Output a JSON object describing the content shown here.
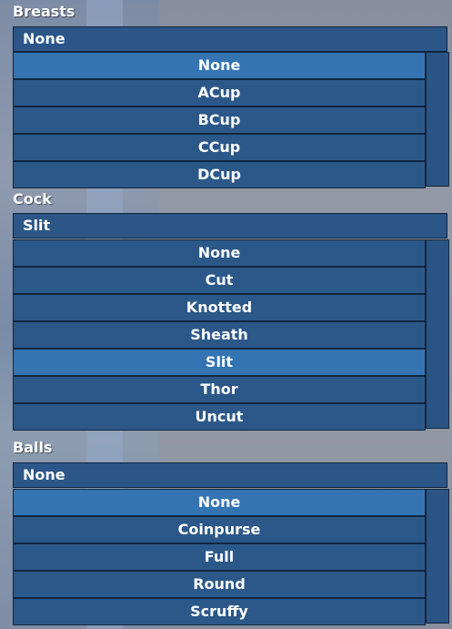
{
  "sections": [
    {
      "title": "Breasts",
      "selected": "None",
      "options": [
        "None",
        "ACup",
        "BCup",
        "CCup",
        "DCup"
      ],
      "highlighted_index": 0
    },
    {
      "title": "Cock",
      "selected": "Slit",
      "options": [
        "None",
        "Cut",
        "Knotted",
        "Sheath",
        "Slit",
        "Thor",
        "Uncut"
      ],
      "highlighted_index": 4
    },
    {
      "title": "Balls",
      "selected": "None",
      "options": [
        "None",
        "Coinpurse",
        "Full",
        "Round",
        "Scruffy"
      ],
      "highlighted_index": 0
    }
  ],
  "colors": {
    "option_bg": "#2c5889",
    "option_selected_bg": "#3474b3",
    "border": "#11263f",
    "text": "#ffffff"
  }
}
